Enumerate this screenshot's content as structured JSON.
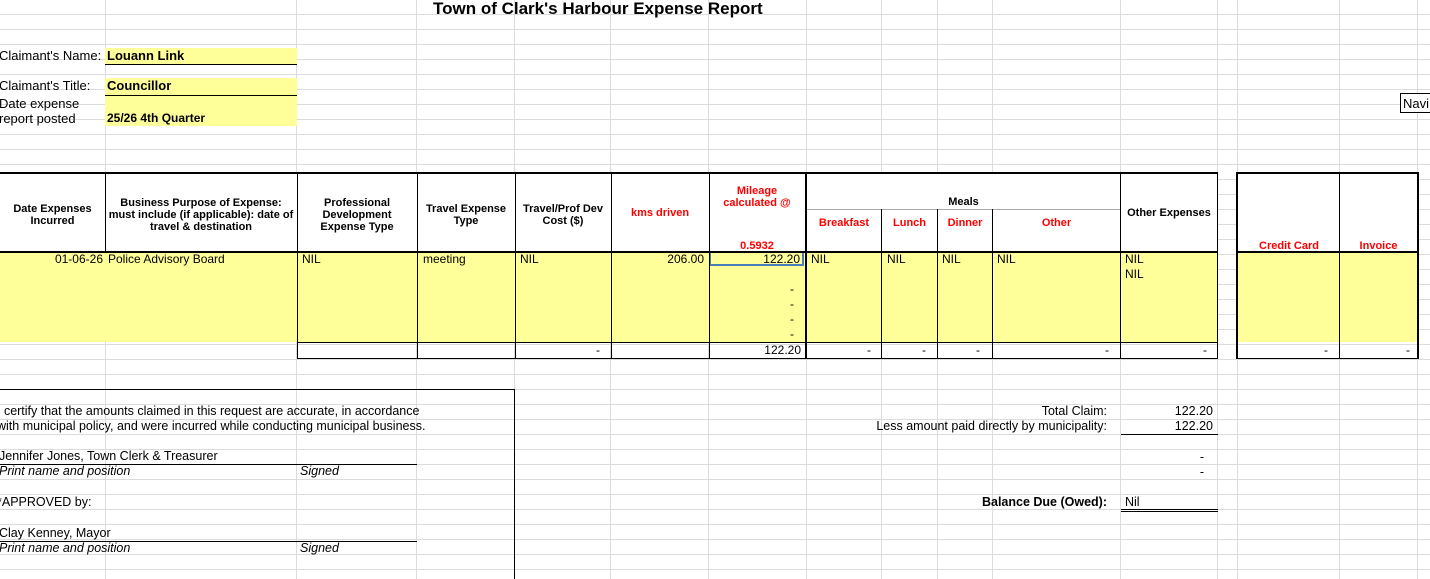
{
  "report": {
    "title": "Town of Clark's Harbour Expense Report",
    "claimant_name_label": "Claimant's Name:",
    "claimant_name": "Louann Link",
    "claimant_title_label": "Claimant's Title:",
    "claimant_title": "Councillor",
    "date_label_line1": "Date expense",
    "date_label_line2": "report posted",
    "date_posted": "25/26 4th Quarter",
    "nav_button": "Navi"
  },
  "columns": {
    "date": "Date Expenses Incurred",
    "purpose": "Business Purpose of Expense: must include (if applicable): date of travel & destination",
    "prof_dev": "Professional Development Expense Type",
    "travel_type": "Travel Expense Type",
    "travel_cost": "Travel/Prof Dev Cost ($)",
    "kms": "kms driven",
    "mileage": "Mileage calculated @",
    "mileage_rate": "0.5932",
    "meals": "Meals",
    "breakfast": "Breakfast",
    "lunch": "Lunch",
    "dinner": "Dinner",
    "other": "Other",
    "other_expenses": "Other Expenses",
    "credit_card": "Credit Card",
    "invoice": "Invoice"
  },
  "row1": {
    "date": "01-06-26",
    "purpose": "Police Advisory Board",
    "prof_dev": "NIL",
    "travel_type": "meeting",
    "travel_cost": "NIL",
    "kms": "206.00",
    "mileage": "122.20",
    "breakfast": "NIL",
    "lunch": "NIL",
    "dinner": "NIL",
    "other": "NIL",
    "other_expenses": "NIL"
  },
  "row2": {
    "other_expenses": "NIL"
  },
  "dash": "-",
  "totals": {
    "travel_cost": "-",
    "mileage": "122.20",
    "breakfast": "-",
    "lunch": "-",
    "dinner": "-",
    "other": "-",
    "other_expenses": "-",
    "credit_card": "-",
    "invoice": "-"
  },
  "certification": {
    "line1": "I certify that the amounts claimed in this request are accurate, in accordance",
    "line2": "with municipal policy, and were incurred while conducting municipal business.",
    "clerk_name": "Jennifer Jones, Town Clerk & Treasurer",
    "print_label": "Print name and position",
    "signed_label": "Signed",
    "approved_label": "*APPROVED by:",
    "mayor_name": "Clay Kenney, Mayor"
  },
  "summary": {
    "total_claim_label": "Total Claim:",
    "total_claim": "122.20",
    "less_paid_label": "Less amount paid directly by municipality:",
    "less_paid": "122.20",
    "dash1": "-",
    "dash2": "-",
    "balance_label": "Balance Due (Owed):",
    "balance": "Nil"
  }
}
